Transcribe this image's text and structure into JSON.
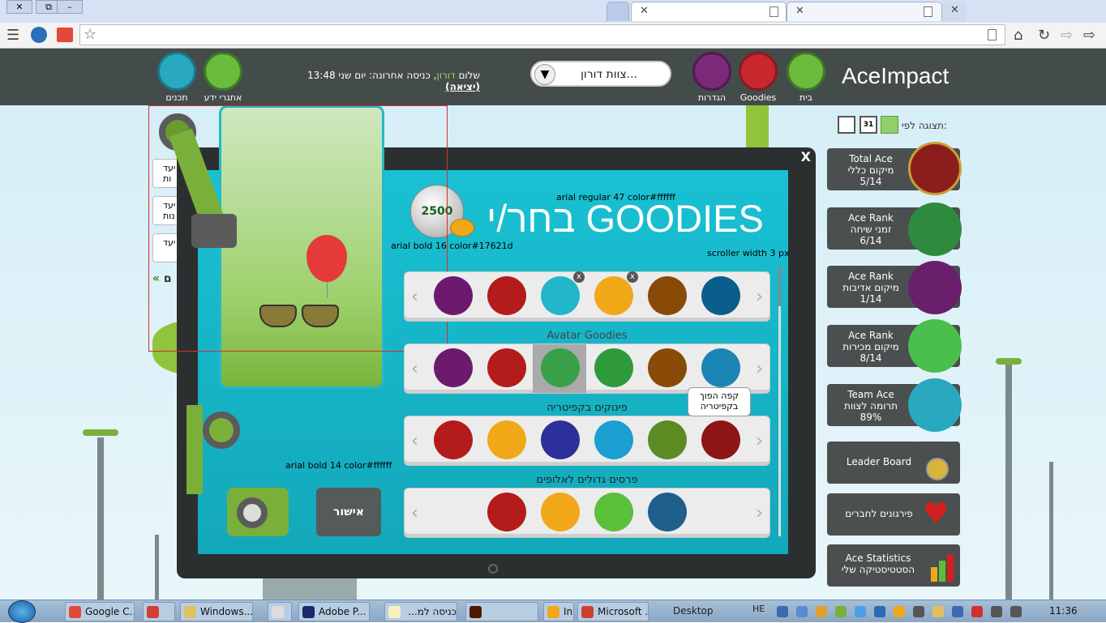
{
  "browser": {
    "tabs": [
      {
        "label": ""
      },
      {
        "label": ""
      }
    ],
    "window_buttons": {
      "close": "✕",
      "restore": "⧉",
      "minimize": "–"
    }
  },
  "header": {
    "logo": "AceImpact",
    "nav": [
      {
        "label": "בית",
        "icon": "home-icon"
      },
      {
        "label": "Goodies",
        "icon": "gift-icon"
      },
      {
        "label": "הגדרות",
        "icon": "gear-icon"
      }
    ],
    "left_nav": [
      {
        "label": "אתגרי ידע",
        "icon": "owl-icon"
      },
      {
        "label": "תכנים",
        "icon": "3d-glasses-icon"
      }
    ],
    "team_select": {
      "value": "צוות דורון..."
    },
    "greeting": {
      "hello": "שלום",
      "name": "דורון",
      "last_login": ", כניסה אחרונה: יום שני 13:48",
      "logout": "(יציאה)"
    }
  },
  "view_by": {
    "label": "תצוגה לפי:",
    "options": [
      "31"
    ]
  },
  "sidebar": {
    "cards": [
      {
        "title": "Total Ace",
        "sub": "מיקום כללי",
        "value": "5/14",
        "icon": "trophy-robot-icon",
        "color": "#8c1d1d"
      },
      {
        "title": "Ace Rank",
        "sub": "זמני שיחה",
        "value": "6/14",
        "icon": "crown-robot-icon",
        "color": "#2e8b3d"
      },
      {
        "title": "Ace Rank",
        "sub": "מיקום אדיבות",
        "value": "1/14",
        "icon": "cup-robot-icon",
        "color": "#6a1f6a"
      },
      {
        "title": "Ace Rank",
        "sub": "מיקום מכירות",
        "value": "8/14",
        "icon": "basket-robot-icon",
        "color": "#4bbf4b"
      },
      {
        "title": "Team Ace",
        "sub": "תרומה לצוות",
        "value": "89%",
        "icon": "team-robots-icon",
        "color": "#28a9c0"
      }
    ],
    "leader_board": "Leader Board",
    "compliments": "פירגונים לחברים",
    "statistics_title": "Ace Statistics",
    "statistics_sub": "הסטטיסטיקה שלי"
  },
  "left_panel": {
    "items": [
      "יעד",
      "יעד",
      "יעד"
    ],
    "sub": [
      "ות",
      "נות",
      ""
    ],
    "more": "ם"
  },
  "modal": {
    "close": "X",
    "title": "בחר/י GOODIES",
    "coins": "2500",
    "note_title_font": "arial regular  47 color#ffffff",
    "note_coins_font": "arial bold 16 color#17621d",
    "note_scroller": "scroller width 3 px",
    "note_button_font": "arial bold 14 color#ffffff",
    "confirm": "אישור",
    "rows": [
      {
        "label": "",
        "items": [
          {
            "icon": "purple-color-icon",
            "color": "#6b1a6e"
          },
          {
            "icon": "red-color-icon",
            "color": "#b41b1b"
          },
          {
            "icon": "sunglasses-icon",
            "color": "#21b6cc"
          },
          {
            "icon": "balloon-icon",
            "color": "#f0a818"
          },
          {
            "icon": "brown-color-icon",
            "color": "#8a4a07"
          },
          {
            "icon": "blue-color-icon",
            "color": "#0b5e8c"
          }
        ]
      },
      {
        "label": "Avatar Goodies",
        "items": [
          {
            "icon": "telescope-icon",
            "color": "#6b1a6e"
          },
          {
            "icon": "binoculars-icon",
            "color": "#b41b1b"
          },
          {
            "icon": "goggles-icon",
            "color": "#3aa048"
          },
          {
            "icon": "eyepatch-icon",
            "color": "#2f9a3b"
          },
          {
            "icon": "drill-icon",
            "color": "#8a4a07"
          },
          {
            "icon": "ufo-icon",
            "color": "#1b86b5"
          }
        ]
      },
      {
        "label": "פינוקים בקפיטריה",
        "items": [
          {
            "icon": "donut-icon",
            "color": "#b41b1b"
          },
          {
            "icon": "smoothie-icon",
            "color": "#f0a818"
          },
          {
            "icon": "ice-cream-icon",
            "color": "#2d2f9b"
          },
          {
            "icon": "juice-icon",
            "color": "#1b9fd1"
          },
          {
            "icon": "cookie-icon",
            "color": "#5c8b24"
          },
          {
            "icon": "coffee-cup-icon",
            "color": "#8c1515"
          }
        ]
      },
      {
        "label": "פרסים גדולים לאלופים",
        "items": [
          {
            "icon": "dinner-plate-icon",
            "color": "#b41b1b"
          },
          {
            "icon": "printer-icon",
            "color": "#f0a818"
          },
          {
            "icon": "mobile-phone-icon",
            "color": "#5cbf3a"
          },
          {
            "icon": "airplane-icon",
            "color": "#1f5f8c"
          }
        ]
      }
    ],
    "tooltip": "קפה הפוך בקפיטריה"
  },
  "taskbar": {
    "items": [
      "Google C...",
      "",
      "Windows...",
      "",
      "Adobe P...",
      "כניסה למ...",
      "",
      "Inb",
      "Microsoft ...",
      "Desktop"
    ],
    "lang": "HE",
    "time": "11:36"
  }
}
